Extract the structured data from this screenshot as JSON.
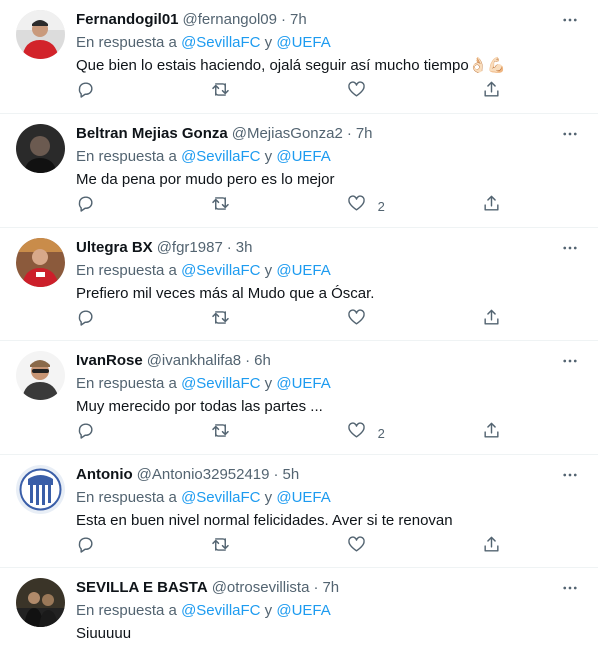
{
  "reply_prefix": "En respuesta a",
  "reply_and": "y",
  "tweets": [
    {
      "name": "Fernandogil01",
      "handle": "@fernangol09",
      "dot": "·",
      "time": "7h",
      "mention1": "@SevillaFC",
      "mention2": "@UEFA",
      "text": "Que bien lo estais haciendo, ojalá seguir así mucho tiempo👌🏻💪🏻",
      "likes": ""
    },
    {
      "name": "Beltran Mejias Gonza",
      "handle": "@MejiasGonza2",
      "dot": "·",
      "time": "7h",
      "mention1": "@SevillaFC",
      "mention2": "@UEFA",
      "text": "Me da pena por mudo pero es lo mejor",
      "likes": "2"
    },
    {
      "name": "Ultegra BX",
      "handle": "@fgr1987",
      "dot": "·",
      "time": "3h",
      "mention1": "@SevillaFC",
      "mention2": "@UEFA",
      "text": "Prefiero mil veces más al Mudo que a Óscar.",
      "likes": ""
    },
    {
      "name": "IvanRose",
      "handle": "@ivankhalifa8",
      "dot": "·",
      "time": "6h",
      "mention1": "@SevillaFC",
      "mention2": "@UEFA",
      "text": "Muy merecido por todas las partes ...",
      "likes": "2"
    },
    {
      "name": "Antonio",
      "handle": "@Antonio32952419",
      "dot": "·",
      "time": "5h",
      "mention1": "@SevillaFC",
      "mention2": "@UEFA",
      "text": "Esta en buen nivel normal felicidades. Aver si te renovan",
      "likes": ""
    },
    {
      "name": "SEVILLA E BASTA",
      "handle": "@otrosevillista",
      "dot": "·",
      "time": "7h",
      "mention1": "@SevillaFC",
      "mention2": "@UEFA",
      "text": "Siuuuuu",
      "likes": ""
    }
  ],
  "icons": {
    "more": "more-horizontal-icon",
    "reply": "reply-icon",
    "retweet": "retweet-icon",
    "like": "heart-icon",
    "share": "share-icon"
  },
  "colors": {
    "link": "#1d9bf0",
    "secondary": "#536471",
    "text": "#0f1419",
    "divider": "#eff3f4"
  }
}
